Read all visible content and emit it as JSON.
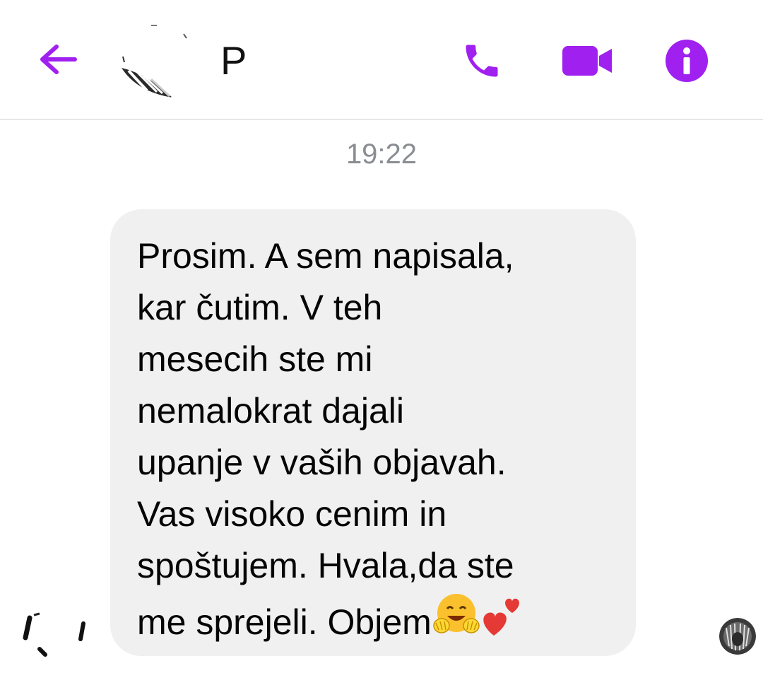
{
  "header": {
    "contact_name": "P",
    "back_icon": "arrow-left-icon",
    "call_icon": "phone-icon",
    "video_icon": "video-camera-icon",
    "info_icon": "info-icon",
    "accent_color": "#a020f0"
  },
  "thread": {
    "timestamp": "19:22",
    "message": {
      "text": "Prosim. A sem napisala,\nkar čutim. V teh\nmesecih ste mi\nnemalokrat dajali\nupanje v vaših objavah.\nVas visoko cenim in\nspoštujem. Hvala,da ste\nme sprejeli. Objem",
      "emojis": [
        "hugging-face-emoji",
        "two-hearts-emoji"
      ],
      "bubble_color": "#f0f0f0"
    }
  }
}
